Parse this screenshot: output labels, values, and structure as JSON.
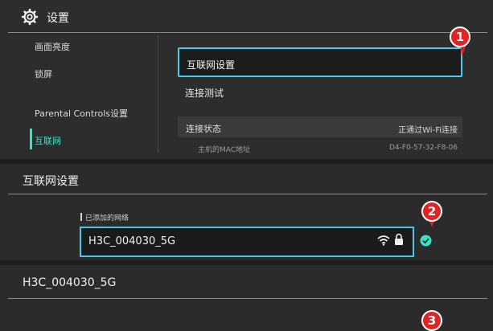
{
  "header": {
    "title": "设置"
  },
  "sidebar": {
    "items": [
      {
        "label": "画面亮度"
      },
      {
        "label": "锁屏"
      },
      {
        "label": "Parental Controls设置"
      },
      {
        "label": "互联网"
      }
    ],
    "active_index": 3
  },
  "main": {
    "menu": [
      {
        "label": "互联网设置"
      },
      {
        "label": "连接测试"
      }
    ],
    "status": {
      "label": "连接状态",
      "value": "正通过Wi-Fi连接",
      "mac_label": "主机的MAC地址",
      "mac_value": "D4-F0-57-32-F8-06"
    }
  },
  "internet_settings": {
    "title": "互联网设置",
    "added_networks_label": "已添加的网络",
    "network": {
      "ssid": "H3C_004030_5G",
      "secured": true,
      "connected": true
    }
  },
  "network_detail": {
    "title": "H3C_004030_5G"
  },
  "annotations": [
    "1",
    "2",
    "3"
  ],
  "colors": {
    "accent": "#2ee6c8",
    "selection_border": "#53c6f0",
    "badge": "#e02424"
  }
}
